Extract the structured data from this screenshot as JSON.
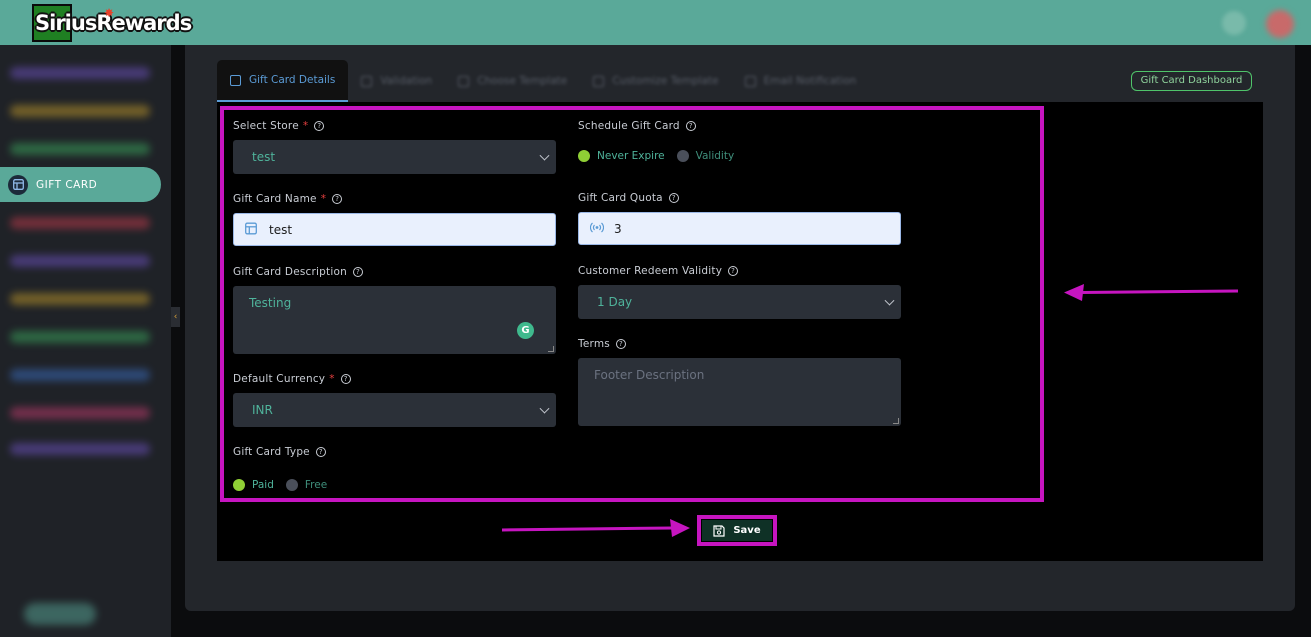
{
  "brand": {
    "name": "SiriusRewards"
  },
  "sidebar": {
    "active_label": "GIFT CARD"
  },
  "tabs": [
    {
      "label": "Gift Card Details",
      "active": true
    },
    {
      "label": "Validation",
      "active": false
    },
    {
      "label": "Choose Template",
      "active": false
    },
    {
      "label": "Customize Template",
      "active": false
    },
    {
      "label": "Email Notification",
      "active": false
    }
  ],
  "header": {
    "dashboard_button": "Gift Card Dashboard"
  },
  "form": {
    "select_store": {
      "label": "Select Store",
      "value": "test"
    },
    "gift_card_name": {
      "label": "Gift Card Name",
      "value": "test"
    },
    "gift_card_description": {
      "label": "Gift Card Description",
      "value": "Testing"
    },
    "default_currency": {
      "label": "Default Currency",
      "value": "INR"
    },
    "gift_card_type": {
      "label": "Gift Card Type",
      "options": [
        "Paid",
        "Free"
      ],
      "selected": "Paid"
    },
    "schedule_gift_card": {
      "label": "Schedule Gift Card",
      "options": [
        "Never Expire",
        "Validity"
      ],
      "selected": "Never Expire"
    },
    "gift_card_quota": {
      "label": "Gift Card Quota",
      "value": "3"
    },
    "customer_redeem_validity": {
      "label": "Customer Redeem Validity",
      "value": "1 Day"
    },
    "terms": {
      "label": "Terms",
      "placeholder": "Footer Description"
    }
  },
  "actions": {
    "save_label": "Save"
  },
  "colors": {
    "accent": "#5aa999",
    "highlight": "#c615c0",
    "radio_on": "#8fcf35"
  }
}
